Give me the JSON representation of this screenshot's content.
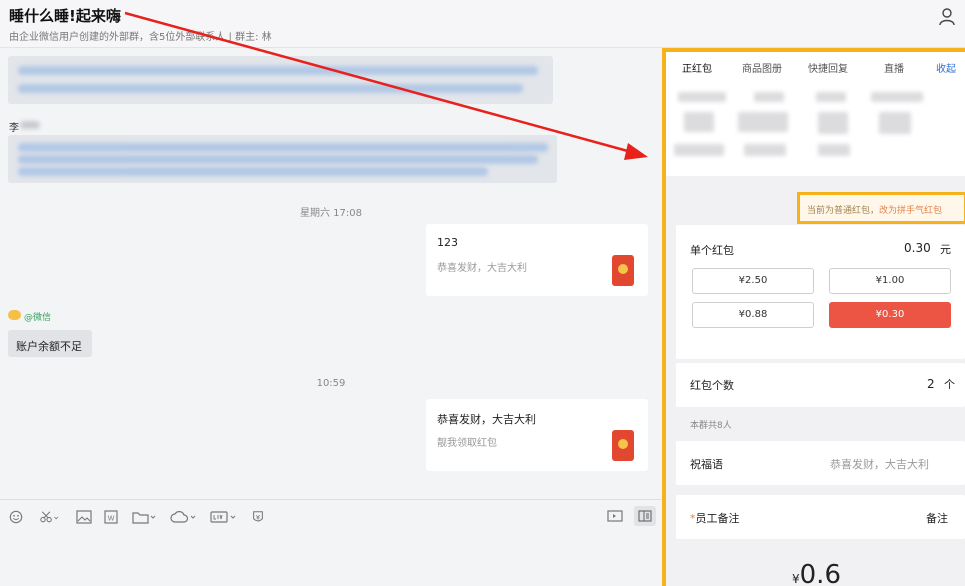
{
  "header": {
    "title": "睡什么睡!起来嗨",
    "subtitle": "由企业微信用户创建的外部群，含5位外部联系人 | 群主: 林"
  },
  "chat": {
    "name1": "李",
    "timestamp1": "星期六 17:08",
    "card1": {
      "title": "123",
      "subtitle": "恭喜发财，大吉大利"
    },
    "sender": "@微信",
    "balance_msg": "账户余额不足",
    "timestamp2": "10:59",
    "card2": {
      "title": "恭喜发财，大吉大利",
      "subtitle": "靓我领取红包"
    }
  },
  "panel": {
    "tabs": [
      "正红包",
      "商品图册",
      "快捷回复",
      "直播",
      "收起"
    ],
    "switch_text": "当前为普通红包，",
    "switch_link": "改为拼手气红包",
    "single_label": "单个红包",
    "single_amount": "0.30",
    "single_unit": "元",
    "options": [
      "¥2.50",
      "¥1.00",
      "¥0.88",
      "¥0.30"
    ],
    "count_label": "红包个数",
    "count_value": "2",
    "count_unit": "个",
    "group_hint": "本群共8人",
    "blessing_label": "祝福语",
    "blessing_placeholder": "恭喜发财，大吉大利",
    "note_required": "*",
    "note_label": "员工备注",
    "note_placeholder": "备注",
    "total_currency": "¥",
    "total": "0.6"
  },
  "colors": {
    "accent_border": "#f5b21b",
    "red": "#ec5444",
    "link": "#2b6fd6"
  }
}
